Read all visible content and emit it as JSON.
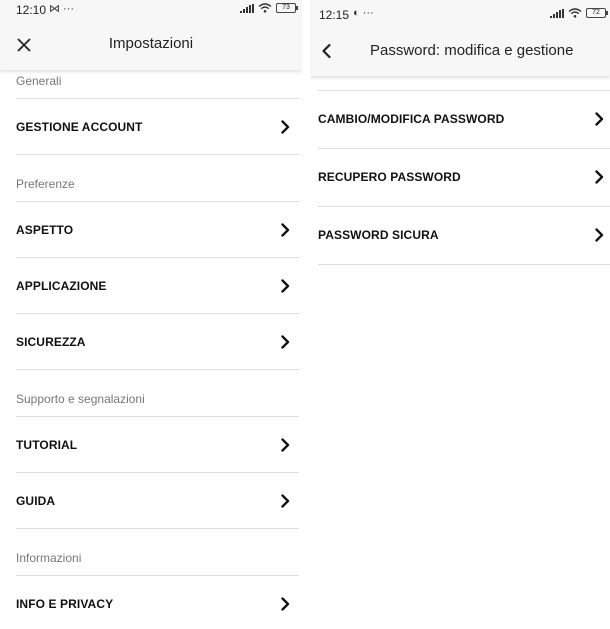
{
  "left": {
    "status": {
      "time": "12:10",
      "extra": "⋈ ···",
      "battery": "73"
    },
    "title": "Impostazioni",
    "sections": [
      {
        "header": "Generali",
        "items": [
          {
            "label": "GESTIONE ACCOUNT"
          }
        ]
      },
      {
        "header": "Preferenze",
        "items": [
          {
            "label": "ASPETTO"
          },
          {
            "label": "APPLICAZIONE"
          },
          {
            "label": "SICUREZZA"
          }
        ]
      },
      {
        "header": "Supporto e segnalazioni",
        "items": [
          {
            "label": "TUTORIAL"
          },
          {
            "label": "GUIDA"
          }
        ]
      },
      {
        "header": "Informazioni",
        "items": [
          {
            "label": "INFO E PRIVACY"
          }
        ]
      }
    ],
    "icons": {
      "nav": "close-icon",
      "row": "chevron-right-icon"
    }
  },
  "right": {
    "status": {
      "time": "12:15",
      "extra": "◐ ···",
      "battery": "72"
    },
    "title": "Password: modifica e gestione",
    "items": [
      {
        "label": "CAMBIO/MODIFICA PASSWORD"
      },
      {
        "label": "RECUPERO PASSWORD"
      },
      {
        "label": "PASSWORD SICURA"
      }
    ],
    "icons": {
      "nav": "back-arrow-icon",
      "row": "chevron-right-icon"
    }
  },
  "colors": {
    "bar_bg": "#f7f7f7",
    "divider": "#dddddd",
    "section_text": "#777777",
    "text": "#111111"
  }
}
